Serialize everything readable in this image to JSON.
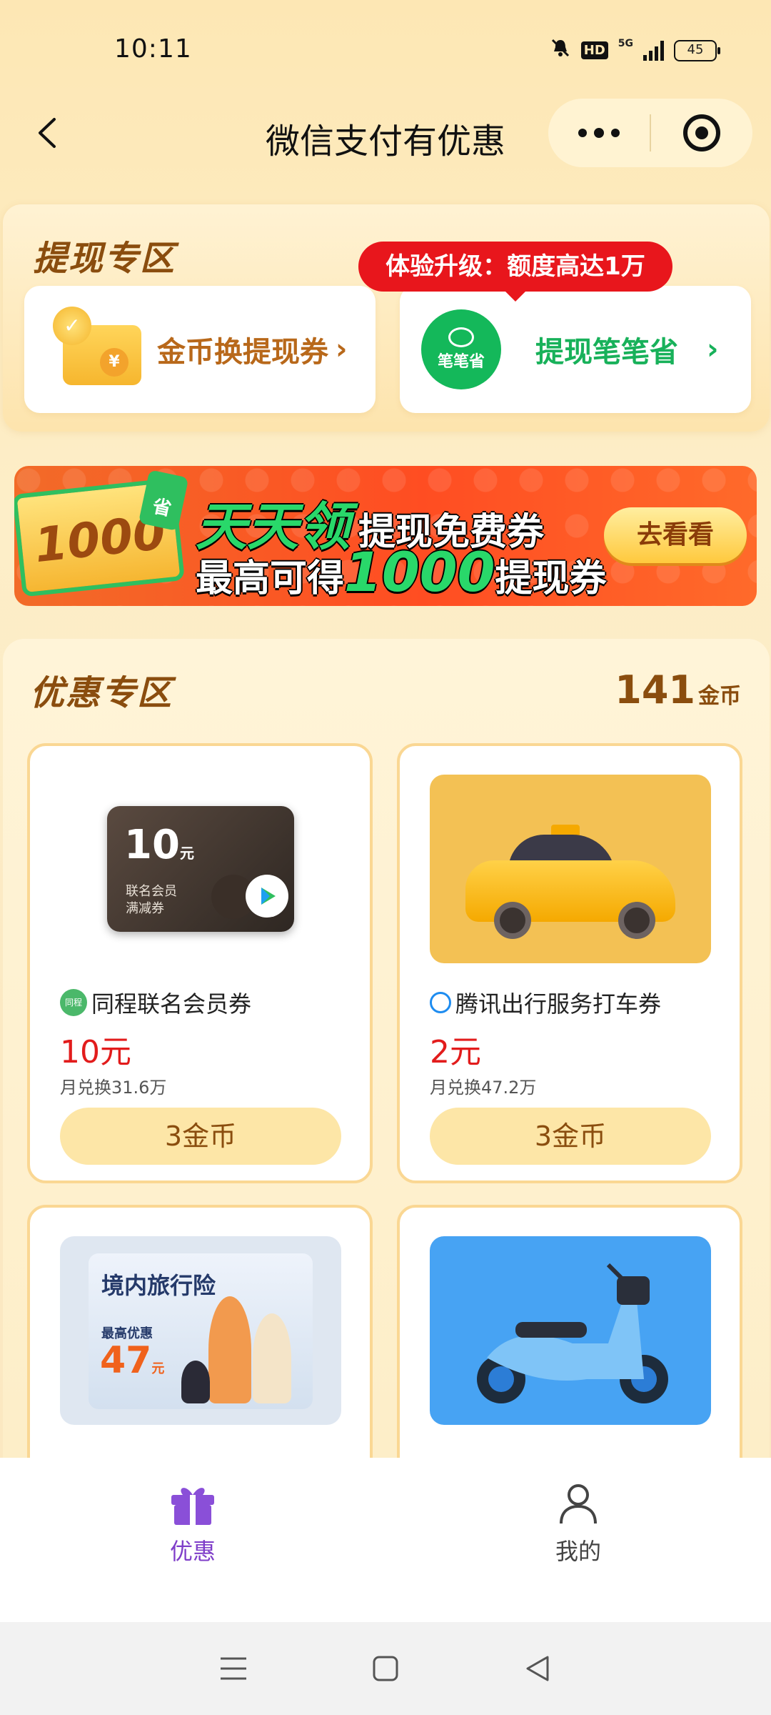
{
  "status_bar": {
    "time": "10:11",
    "network": "5G",
    "hd_label": "HD",
    "battery": "45",
    "icons": [
      "mute-icon",
      "hd-icon",
      "signal-icon",
      "battery-icon"
    ]
  },
  "nav": {
    "title": "微信支付有优惠",
    "back_icon": "chevron-left-icon",
    "more_icon": "more-dots-icon",
    "close_icon": "target-close-icon"
  },
  "withdraw_zone": {
    "title": "提现专区",
    "tooltip": "体验升级：额度高达1万",
    "left_item": {
      "label": "金币换提现券",
      "icon": "coin-wallet-icon"
    },
    "right_item": {
      "label": "提现笔笔省",
      "logo_text": "笔笔省",
      "icon": "bibisheng-logo"
    }
  },
  "banner": {
    "ticket_amount": "1000",
    "ticket_tag": "省",
    "line1_highlight": "天天领",
    "line1_text": "提现免费券",
    "line2_prefix": "最高可得",
    "line2_number": "1000",
    "line2_suffix": "提现券",
    "button": "去看看"
  },
  "deals_zone": {
    "title": "优惠专区",
    "coin_balance": "141",
    "coin_unit": "金币",
    "items": [
      {
        "name": "同程联名会员券",
        "brand_icon_text": "同程",
        "price": "10元",
        "sales": "月兑换31.6万",
        "button": "3金币",
        "image": {
          "amount": "10",
          "unit": "元",
          "line1": "联名会员",
          "line2": "满减券"
        }
      },
      {
        "name": "腾讯出行服务打车券",
        "price": "2元",
        "sales": "月兑换47.2万",
        "button": "3金币",
        "image": {
          "kind": "taxi"
        }
      },
      {
        "image": {
          "title": "境内旅行险",
          "sub": "最高优惠",
          "amount": "47",
          "unit": "元"
        }
      },
      {
        "image": {
          "kind": "e-bike"
        }
      }
    ]
  },
  "tabbar": {
    "tabs": [
      {
        "label": "优惠",
        "icon": "gift-icon",
        "active": true
      },
      {
        "label": "我的",
        "icon": "person-icon",
        "active": false
      }
    ]
  },
  "colors": {
    "accent_brown": "#8a4d0e",
    "price_red": "#e21c1c",
    "green": "#18b15a",
    "tab_active": "#7f3ec9"
  }
}
